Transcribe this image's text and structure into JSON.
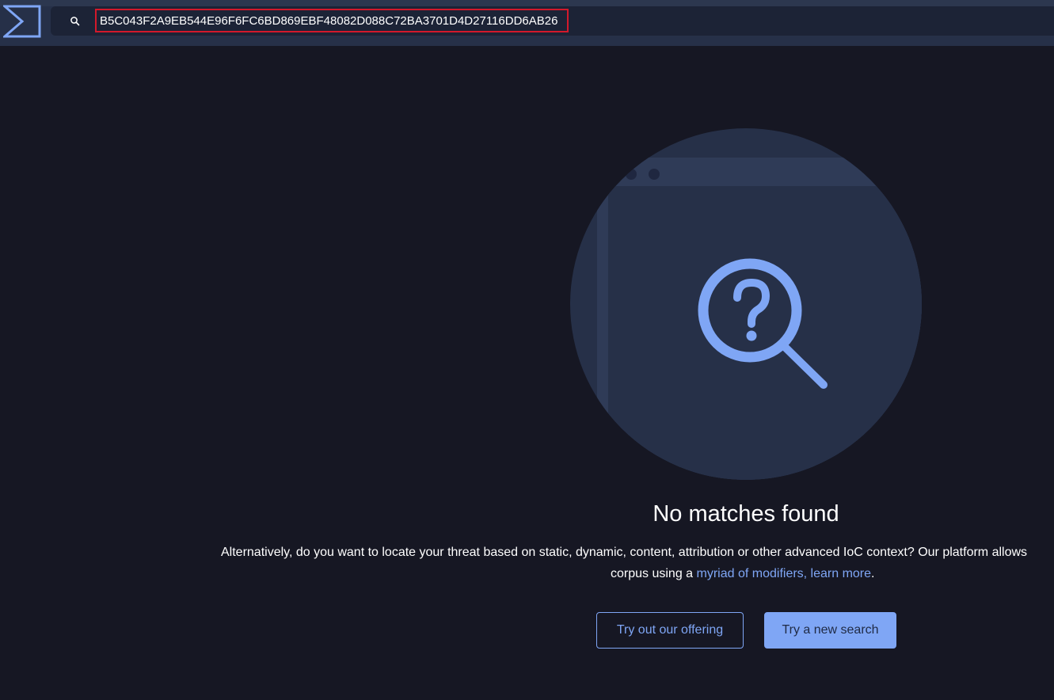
{
  "header": {
    "search_query": "B5C043F2A9EB544E96F6FC6BD869EBF48082D088C72BA3701D4D27116DD6AB26",
    "logo_icon": "sigma-logo-icon",
    "search_icon": "search-icon"
  },
  "empty_state": {
    "illustration_icon": "question-magnifier-icon",
    "title": "No matches found",
    "description_line1": "Alternatively, do you want to locate your threat based on static, dynamic, content, attribution or other advanced IoC context? Our platform allows",
    "description_line2_prefix": "corpus using a ",
    "description_link": "myriad of modifiers, learn more",
    "description_line2_suffix": ".",
    "secondary_button": "Try out our offering",
    "primary_button": "Try a new search"
  },
  "colors": {
    "background": "#161723",
    "header": "#263048",
    "accent": "#7fa6f5",
    "highlight_border": "#d3192b"
  }
}
